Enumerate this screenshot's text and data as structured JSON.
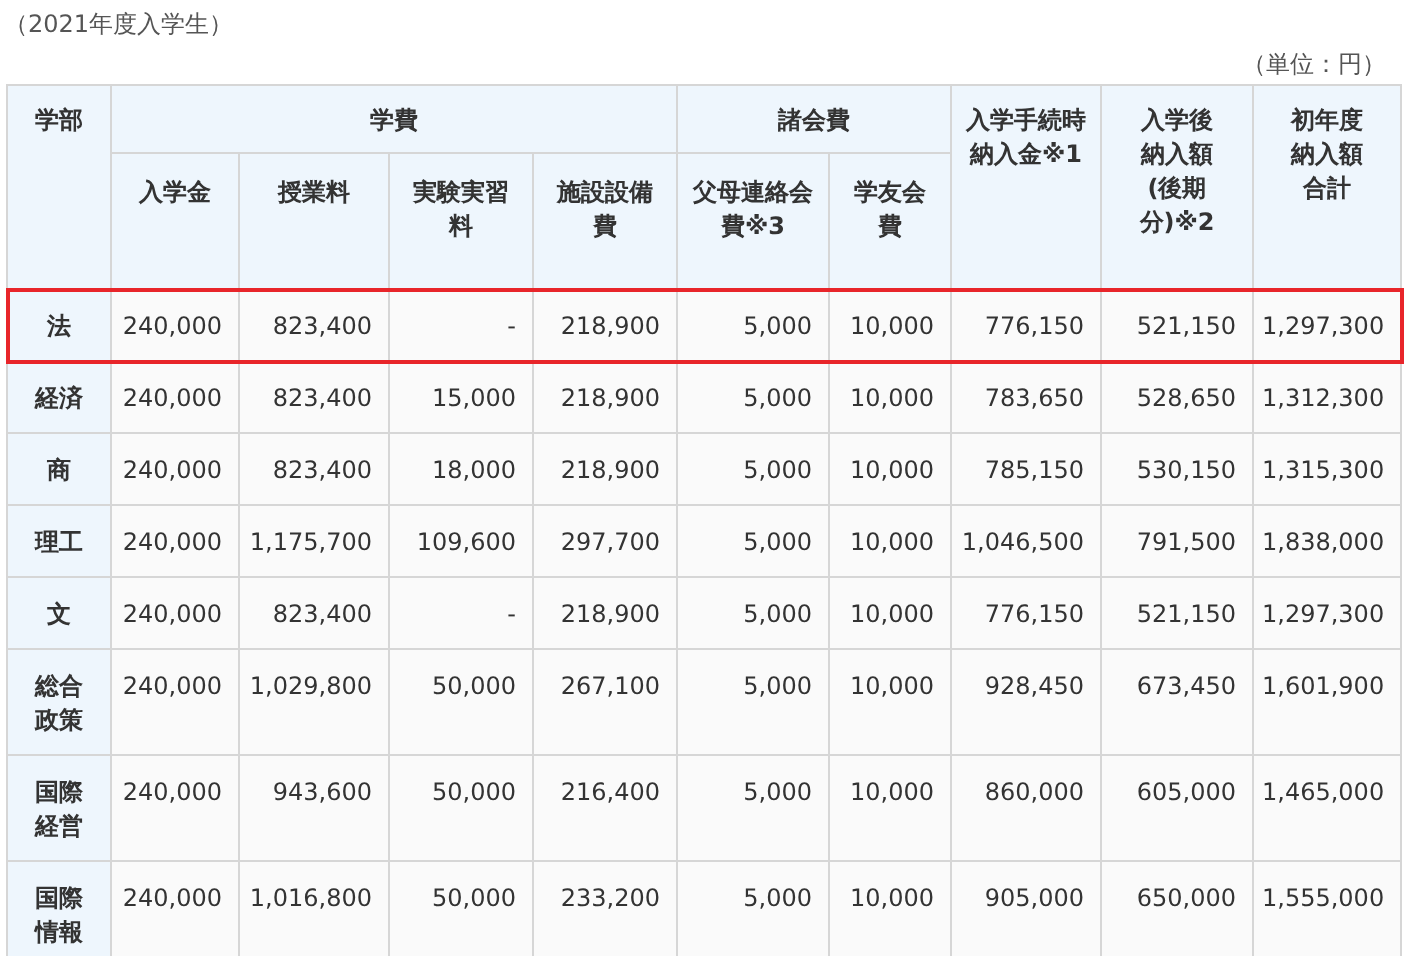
{
  "caption": "（2021年度入学生）",
  "unit": "（単位：円）",
  "headers": [
    {
      "label": "学部"
    },
    {
      "label": "学費",
      "children": [
        "入学金",
        "授業料",
        "実験実習料",
        "施設設備費"
      ]
    },
    {
      "label": "諸会費",
      "children": [
        "父母連絡会費※3",
        "学友会費"
      ]
    },
    {
      "label": "入学手続時納入金※1"
    },
    {
      "label": "入学後納入額(後期分)※2"
    },
    {
      "label": "初年度納入額合計"
    }
  ],
  "rows": [
    {
      "faculty": "法",
      "highlighted": true,
      "cells": [
        "240,000",
        "823,400",
        "-",
        "218,900",
        "5,000",
        "10,000",
        "776,150",
        "521,150",
        "1,297,300"
      ]
    },
    {
      "faculty": "経済",
      "highlighted": false,
      "cells": [
        "240,000",
        "823,400",
        "15,000",
        "218,900",
        "5,000",
        "10,000",
        "783,650",
        "528,650",
        "1,312,300"
      ]
    },
    {
      "faculty": "商",
      "highlighted": false,
      "cells": [
        "240,000",
        "823,400",
        "18,000",
        "218,900",
        "5,000",
        "10,000",
        "785,150",
        "530,150",
        "1,315,300"
      ]
    },
    {
      "faculty": "理工",
      "highlighted": false,
      "cells": [
        "240,000",
        "1,175,700",
        "109,600",
        "297,700",
        "5,000",
        "10,000",
        "1,046,500",
        "791,500",
        "1,838,000"
      ]
    },
    {
      "faculty": "文",
      "highlighted": false,
      "cells": [
        "240,000",
        "823,400",
        "-",
        "218,900",
        "5,000",
        "10,000",
        "776,150",
        "521,150",
        "1,297,300"
      ]
    },
    {
      "faculty": "総合政策",
      "highlighted": false,
      "cells": [
        "240,000",
        "1,029,800",
        "50,000",
        "267,100",
        "5,000",
        "10,000",
        "928,450",
        "673,450",
        "1,601,900"
      ]
    },
    {
      "faculty": "国際経営",
      "highlighted": false,
      "cells": [
        "240,000",
        "943,600",
        "50,000",
        "216,400",
        "5,000",
        "10,000",
        "860,000",
        "605,000",
        "1,465,000"
      ]
    },
    {
      "faculty": "国際情報",
      "highlighted": false,
      "cells": [
        "240,000",
        "1,016,800",
        "50,000",
        "233,200",
        "5,000",
        "10,000",
        "905,000",
        "650,000",
        "1,555,000"
      ]
    }
  ]
}
